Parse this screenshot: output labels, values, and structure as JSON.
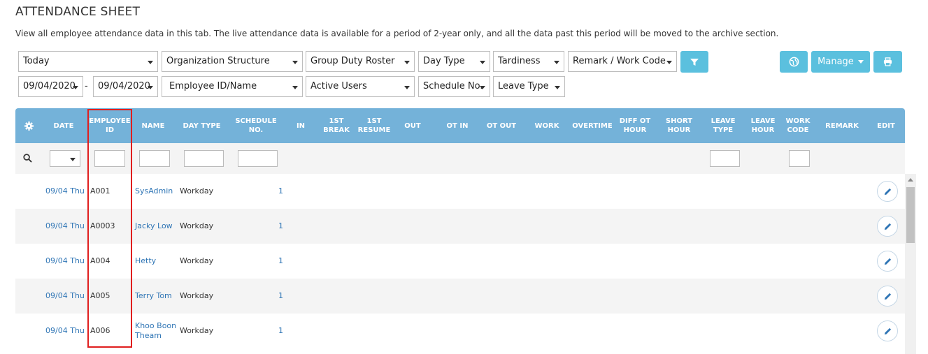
{
  "page": {
    "title": "ATTENDANCE SHEET",
    "description": "View all employee attendance data in this tab. The live attendance data is available for a period of 2-year only, and all the data past this period will be moved to the archive section."
  },
  "filters": {
    "row1": [
      "Today",
      "Organization Structure",
      "Group Duty Roster",
      "Day Type",
      "Tardiness",
      "Remark / Work Code"
    ],
    "date_from": "09/04/2020",
    "date_to": "09/04/2020",
    "date_separator": "-",
    "row2": [
      "Employee ID/Name",
      "Active Users",
      "Schedule No.",
      "Leave Type"
    ]
  },
  "toolbar": {
    "manage_label": "Manage",
    "accent_color": "#5bc0de",
    "icons": [
      "filter-icon",
      "globe-icon",
      "print-icon"
    ]
  },
  "table": {
    "header_color": "#74b2d9",
    "columns": [
      "DATE",
      "EMPLOYEE ID",
      "NAME",
      "DAY TYPE",
      "SCHEDULE NO.",
      "IN",
      "1ST BREAK",
      "1ST RESUME",
      "OUT",
      "OT IN",
      "OT OUT",
      "WORK",
      "OVERTIME",
      "DIFF OT HOUR",
      "SHORT HOUR",
      "LEAVE TYPE",
      "LEAVE HOUR",
      "WORK CODE",
      "REMARK",
      "EDIT"
    ],
    "rows": [
      {
        "date": "09/04 Thu",
        "employee_id": "A001",
        "name": "SysAdmin",
        "day_type": "Workday",
        "schedule_no": "1"
      },
      {
        "date": "09/04 Thu",
        "employee_id": "A0003",
        "name": "Jacky Low",
        "day_type": "Workday",
        "schedule_no": "1"
      },
      {
        "date": "09/04 Thu",
        "employee_id": "A004",
        "name": "Hetty",
        "day_type": "Workday",
        "schedule_no": "1"
      },
      {
        "date": "09/04 Thu",
        "employee_id": "A005",
        "name": "Terry Tom",
        "day_type": "Workday",
        "schedule_no": "1"
      },
      {
        "date": "09/04 Thu",
        "employee_id": "A006",
        "name": "Khoo Boon Theam",
        "day_type": "Workday",
        "schedule_no": "1"
      }
    ]
  },
  "highlight_color": "#e01e1e"
}
